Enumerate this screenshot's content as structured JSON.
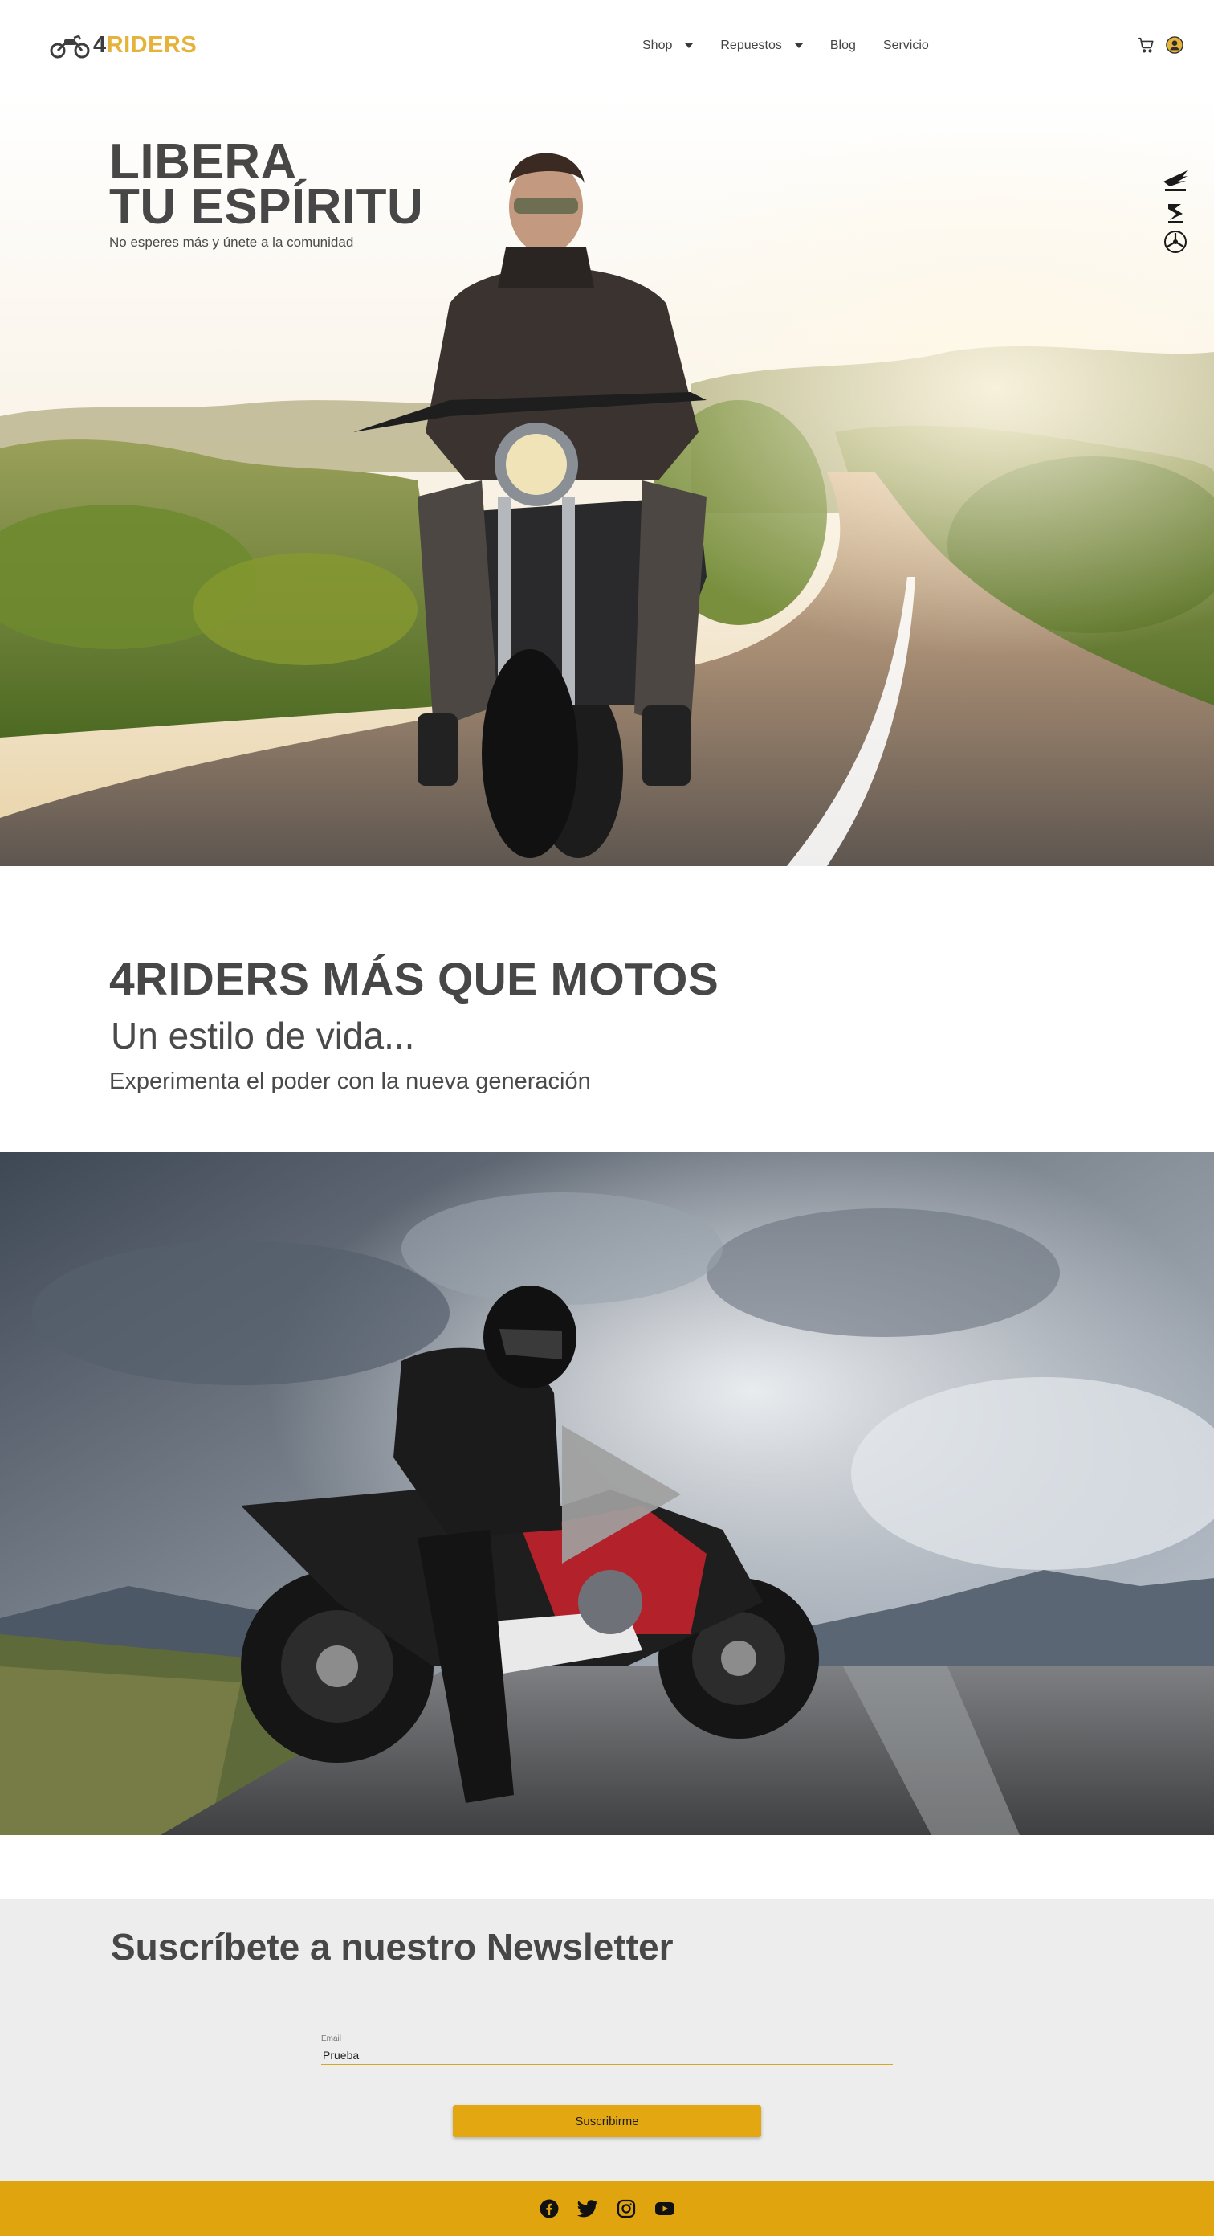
{
  "header": {
    "logo": {
      "number": "4",
      "word": "RIDERS",
      "accent_color": "#e5b23b",
      "icon": "motorcycle-icon"
    },
    "nav": [
      {
        "label": "Shop",
        "has_dropdown": true
      },
      {
        "label": "Repuestos",
        "has_dropdown": true
      },
      {
        "label": "Blog",
        "has_dropdown": false
      },
      {
        "label": "Servicio",
        "has_dropdown": false
      }
    ],
    "icons": [
      "cart-icon",
      "user-icon"
    ]
  },
  "hero": {
    "title_line1": "LIBERA",
    "title_line2": "TU ESPÍRITU",
    "subtitle": "No esperes más y únete a la comunidad",
    "brand_icons": [
      "honda-wing-icon",
      "suzuki-s-icon",
      "yamaha-tuning-fork-icon"
    ]
  },
  "intro": {
    "heading": "4RIDERS MÁS QUE MOTOS",
    "subheading": "Un estilo de vida...",
    "text": "Experimenta el poder con la nueva generación"
  },
  "video": {
    "icon": "play-icon"
  },
  "newsletter": {
    "title": "Suscríbete a nuestro Newsletter",
    "email_label": "Email",
    "email_value": "Prueba",
    "button_label": "Suscribirme",
    "button_color": "#e3a712"
  },
  "footer": {
    "color": "#e0a50e",
    "social": [
      "facebook-icon",
      "twitter-icon",
      "instagram-icon",
      "youtube-icon"
    ]
  }
}
